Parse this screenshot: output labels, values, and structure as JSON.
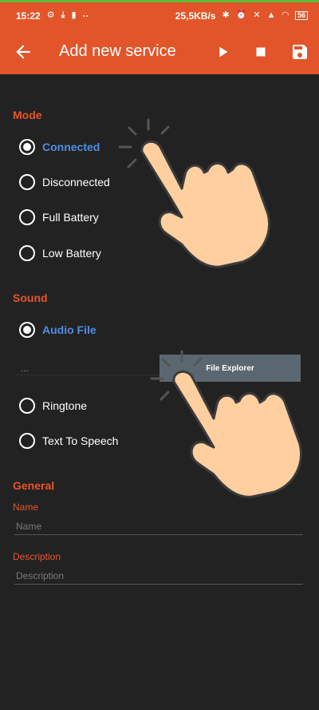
{
  "status_bar": {
    "time": "15:22",
    "speed": "25,5KB/s",
    "more": "··",
    "battery": "56"
  },
  "app_bar": {
    "title": "Add new service",
    "back_icon": "arrow-left-icon",
    "actions": [
      "play-icon",
      "stop-icon",
      "save-icon"
    ]
  },
  "mode": {
    "title": "Mode",
    "options": [
      {
        "label": "Connected",
        "checked": true
      },
      {
        "label": "Disconnected",
        "checked": false
      },
      {
        "label": "Full Battery",
        "checked": false
      },
      {
        "label": "Low Battery",
        "checked": false
      }
    ]
  },
  "sound": {
    "title": "Sound",
    "options": [
      {
        "label": "Audio File",
        "checked": true
      },
      {
        "label": "Ringtone",
        "checked": false
      },
      {
        "label": "Text To Speech",
        "checked": false
      }
    ],
    "file_path": "...",
    "file_button": "File Explorer"
  },
  "general": {
    "title": "General",
    "name_label": "Name",
    "name_placeholder": "Name",
    "description_label": "Description",
    "description_placeholder": "Description"
  },
  "colors": {
    "accent": "#e2552a",
    "selected": "#4d8fe6",
    "background": "#222222",
    "button": "#5b6770"
  }
}
